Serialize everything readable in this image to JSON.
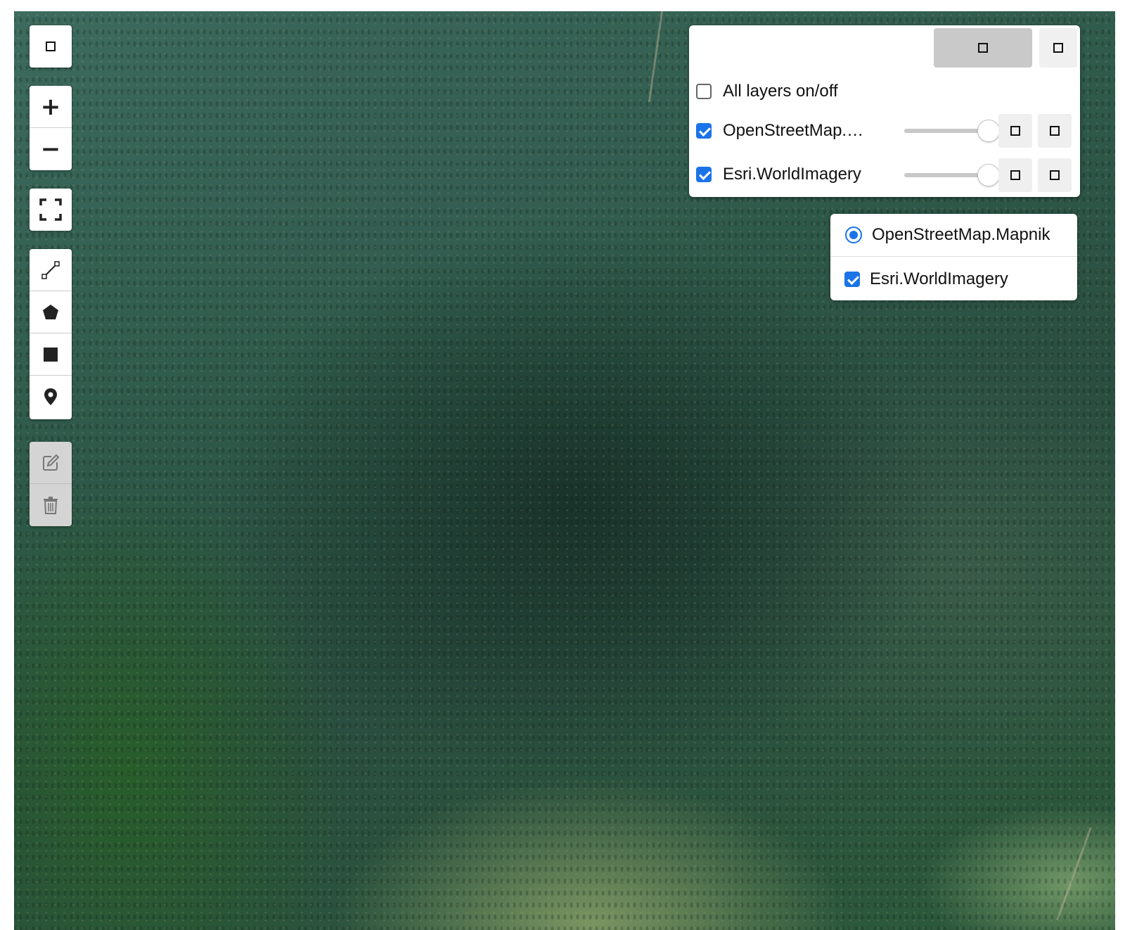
{
  "map": {
    "basemap": "Esri.WorldImagery"
  },
  "layer_control": {
    "all_layers_label": "All layers on/off",
    "all_layers_checked": false,
    "layers": [
      {
        "label": "OpenStreetMap.…",
        "checked": true,
        "opacity": 1.0
      },
      {
        "label": "Esri.WorldImagery",
        "checked": true,
        "opacity": 1.0
      }
    ]
  },
  "basemap_control": {
    "options": [
      {
        "label": "OpenStreetMap.Mapnik",
        "type": "radio",
        "selected": true
      },
      {
        "label": "Esri.WorldImagery",
        "type": "checkbox",
        "checked": true
      }
    ]
  },
  "toolbar": {
    "zoom_in": "+",
    "zoom_out": "−"
  },
  "icons": {
    "toggle": "square-icon",
    "fullscreen": "fullscreen-icon",
    "polyline": "polyline-icon",
    "polygon": "polygon-icon",
    "rectangle": "rectangle-icon",
    "marker": "marker-icon",
    "edit": "edit-icon",
    "delete": "trash-icon"
  },
  "colors": {
    "accent": "#1a73e8",
    "disabled_bar": "#d4d4d4"
  }
}
